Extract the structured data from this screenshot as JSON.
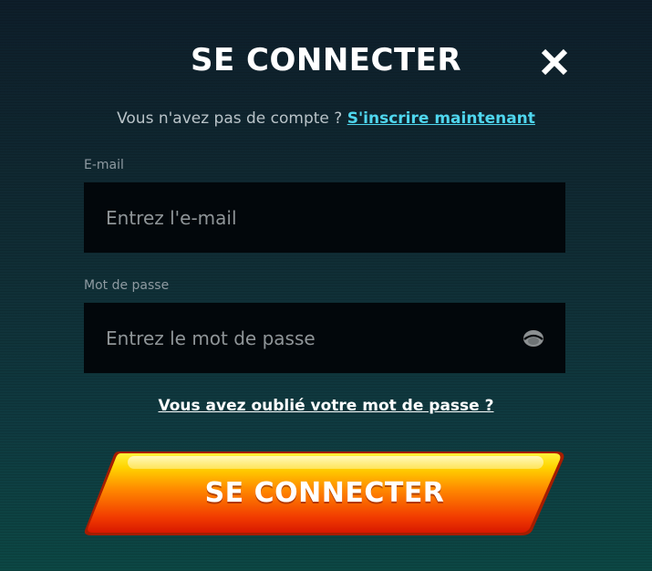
{
  "dialog": {
    "title": "SE CONNECTER",
    "close_icon": "close-icon"
  },
  "signup": {
    "prompt": "Vous n'avez pas de compte ?",
    "link": "S'inscrire maintenant"
  },
  "email": {
    "label": "E-mail",
    "placeholder": "Entrez l'e-mail",
    "value": ""
  },
  "password": {
    "label": "Mot de passe",
    "placeholder": "Entrez le mot de passe",
    "value": "",
    "toggle_icon": "eye-icon"
  },
  "forgot_password": "Vous avez oublié votre mot de passe ?",
  "submit": {
    "label": "SE CONNECTER"
  },
  "colors": {
    "background_top": "#0e1e2a",
    "background_bottom": "#0c4744",
    "input_background": "#02070b",
    "link": "#4fd6ee",
    "button_top": "#ffe600",
    "button_bottom": "#e01e00"
  }
}
